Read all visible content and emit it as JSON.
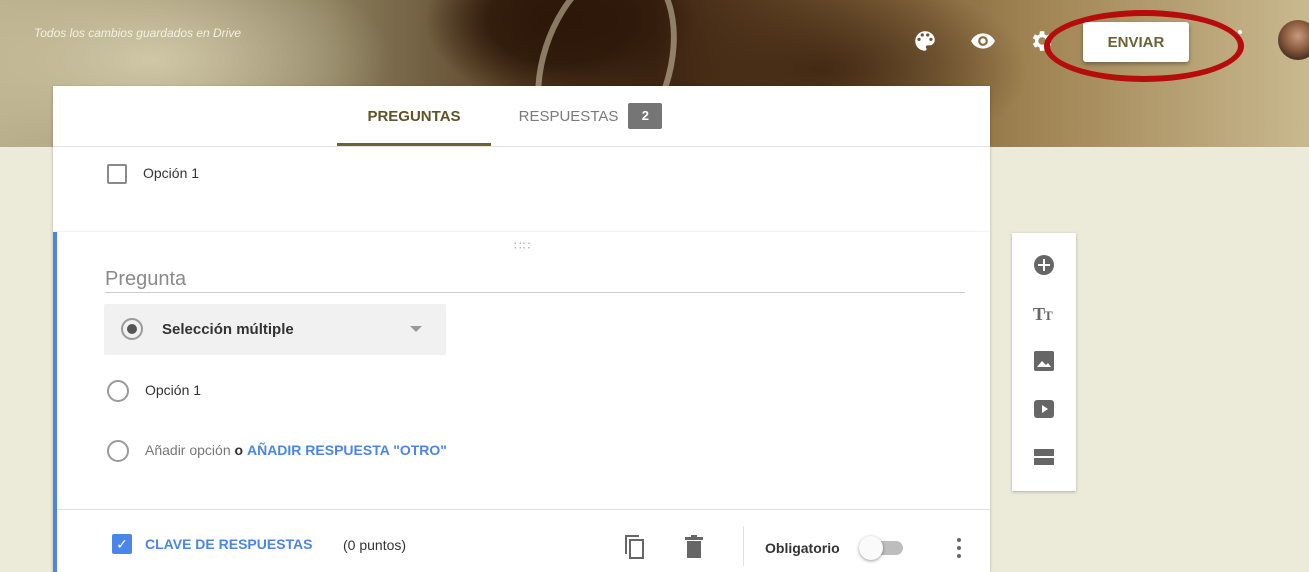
{
  "header": {
    "save_status": "Todos los cambios guardados en Drive",
    "icons": [
      "palette-icon",
      "eye-icon",
      "gear-icon"
    ],
    "send_button": "ENVIAR"
  },
  "tabs": {
    "questions": "PREGUNTAS",
    "responses": "RESPUESTAS",
    "responses_count": "2"
  },
  "previous_question": {
    "option_1": "Opción 1"
  },
  "question": {
    "placeholder": "Pregunta",
    "type": "Selección múltiple",
    "option_1": "Opción 1",
    "add_option": "Añadir opción",
    "or": "o",
    "add_other": "AÑADIR RESPUESTA \"OTRO\"",
    "answer_key": "CLAVE DE RESPUESTAS",
    "points": "(0 puntos)",
    "required": "Obligatorio",
    "required_on": false
  },
  "toolbar": {
    "items": [
      "add-question-icon",
      "title-text-icon",
      "image-icon",
      "video-icon",
      "section-icon"
    ]
  },
  "colors": {
    "accent": "#4a86e8",
    "header_text": "#6b6236",
    "annotation": "#b50c0c"
  }
}
